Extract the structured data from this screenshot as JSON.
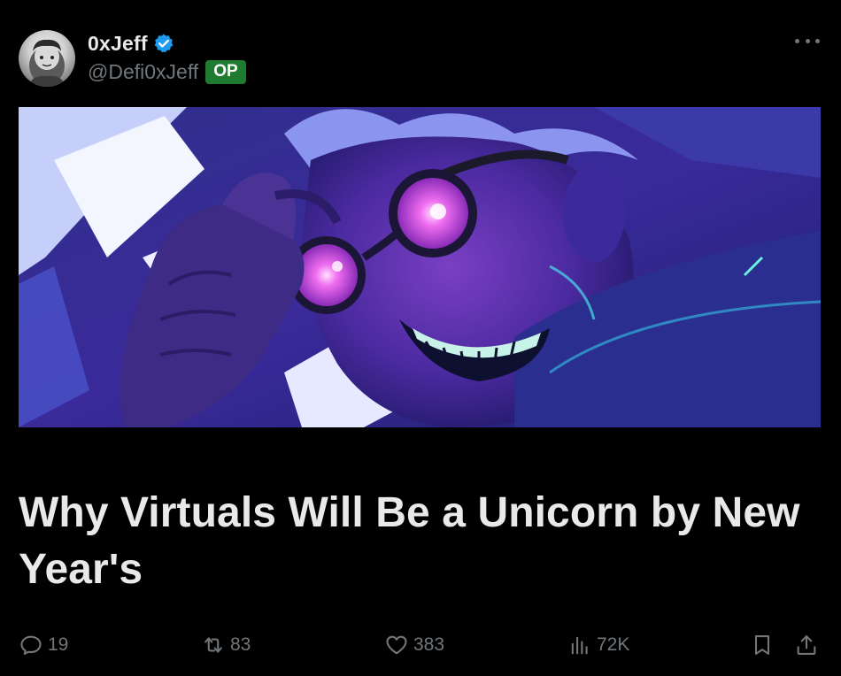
{
  "author": {
    "display_name": "0xJeff",
    "handle": "@Defi0xJeff",
    "badge": "OP",
    "verified_color": "#1d9bf0",
    "badge_color": "#1e7b2f"
  },
  "post": {
    "title": "Why Virtuals Will Be a Unicorn by New Year's"
  },
  "actions": {
    "replies": "19",
    "reposts": "83",
    "likes": "383",
    "views": "72K"
  },
  "icons": {
    "more": "more-options-icon",
    "reply": "reply-icon",
    "repost": "repost-icon",
    "like": "heart-icon",
    "views": "views-chart-icon",
    "bookmark": "bookmark-icon",
    "share": "share-icon"
  }
}
